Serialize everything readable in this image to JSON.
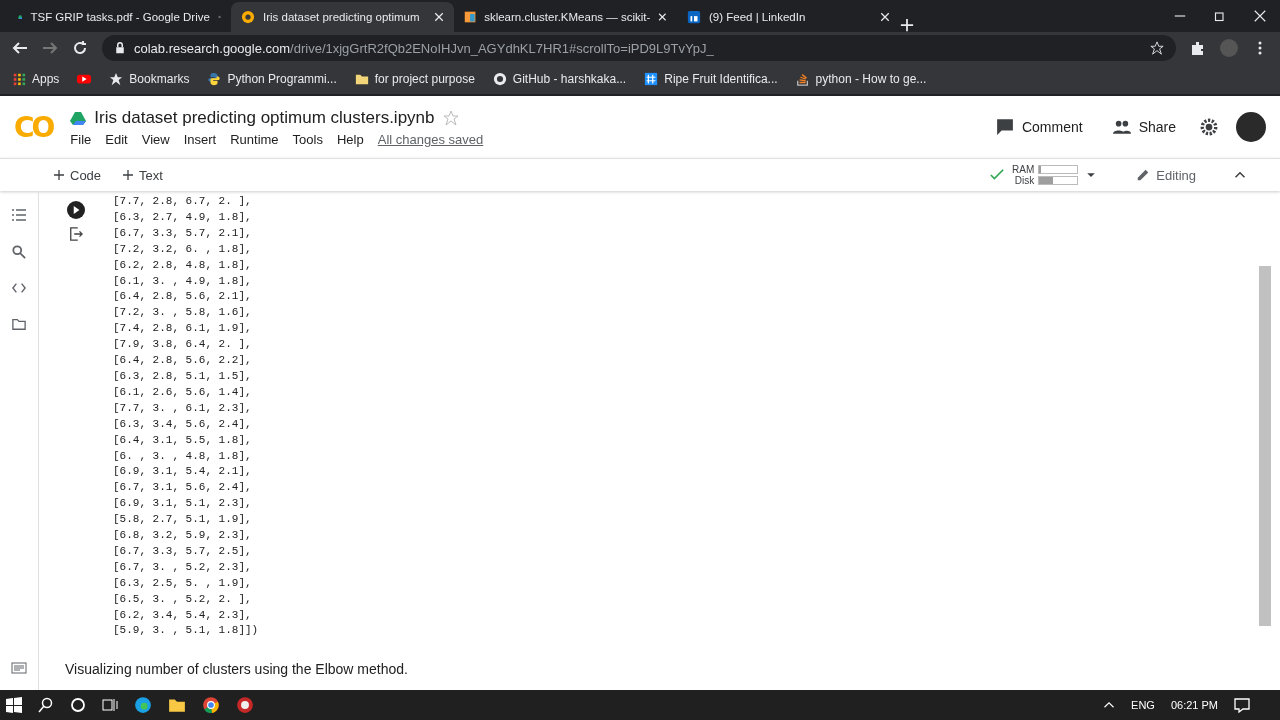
{
  "browser": {
    "tabs": [
      {
        "title": "TSF GRIP tasks.pdf - Google Drive",
        "selected": false
      },
      {
        "title": "Iris dataset predicting optimum",
        "selected": true
      },
      {
        "title": "sklearn.cluster.KMeans — scikit-",
        "selected": false
      },
      {
        "title": "(9) Feed | LinkedIn",
        "selected": false
      }
    ],
    "address": {
      "host": "colab.research.google.com",
      "path": "/drive/1xjgGrtR2fQb2ENoIHJvn_AGYdhKL7HR1#scrollTo=iPD9L9TvYpJ_"
    },
    "bookmarks": [
      {
        "kind": "labeled",
        "label": "Apps"
      },
      {
        "kind": "icon"
      },
      {
        "kind": "labeled",
        "label": "Bookmarks"
      },
      {
        "kind": "labeled",
        "label": "Python Programmi..."
      },
      {
        "kind": "labeled",
        "label": "for project purpose"
      },
      {
        "kind": "labeled",
        "label": "GitHub - harshkaka..."
      },
      {
        "kind": "labeled",
        "label": "Ripe Fruit Identifica..."
      },
      {
        "kind": "labeled",
        "label": "python - How to ge..."
      }
    ]
  },
  "colab": {
    "logo": "CO",
    "title": "Iris dataset predicting optimum clusters.ipynb",
    "menu": [
      "File",
      "Edit",
      "View",
      "Insert",
      "Runtime",
      "Tools",
      "Help"
    ],
    "save_status": "All changes saved",
    "actions": [
      {
        "label": "Comment"
      },
      {
        "label": "Share"
      }
    ],
    "toolbar": {
      "add": [
        {
          "label": "Code"
        },
        {
          "label": "Text"
        }
      ],
      "ram": {
        "label": "RAM",
        "level": 0.05
      },
      "disk": {
        "label": "Disk",
        "level": 0.35
      },
      "mode": "Editing"
    },
    "output_lines": [
      "[7.7, 2.8, 6.7, 2. ],",
      "[6.3, 2.7, 4.9, 1.8],",
      "[6.7, 3.3, 5.7, 2.1],",
      "[7.2, 3.2, 6. , 1.8],",
      "[6.2, 2.8, 4.8, 1.8],",
      "[6.1, 3. , 4.9, 1.8],",
      "[6.4, 2.8, 5.6, 2.1],",
      "[7.2, 3. , 5.8, 1.6],",
      "[7.4, 2.8, 6.1, 1.9],",
      "[7.9, 3.8, 6.4, 2. ],",
      "[6.4, 2.8, 5.6, 2.2],",
      "[6.3, 2.8, 5.1, 1.5],",
      "[6.1, 2.6, 5.6, 1.4],",
      "[7.7, 3. , 6.1, 2.3],",
      "[6.3, 3.4, 5.6, 2.4],",
      "[6.4, 3.1, 5.5, 1.8],",
      "[6. , 3. , 4.8, 1.8],",
      "[6.9, 3.1, 5.4, 2.1],",
      "[6.7, 3.1, 5.6, 2.4],",
      "[6.9, 3.1, 5.1, 2.3],",
      "[5.8, 2.7, 5.1, 1.9],",
      "[6.8, 3.2, 5.9, 2.3],",
      "[6.7, 3.3, 5.7, 2.5],",
      "[6.7, 3. , 5.2, 2.3],",
      "[6.3, 2.5, 5. , 1.9],",
      "[6.5, 3. , 5.2, 2. ],",
      "[6.2, 3.4, 5.4, 2.3],",
      "[5.9, 3. , 5.1, 1.8]])"
    ],
    "text_cell": "Visualizing number of clusters using the Elbow method."
  },
  "taskbar": {
    "language": "ENG",
    "time": "06:21 PM"
  }
}
